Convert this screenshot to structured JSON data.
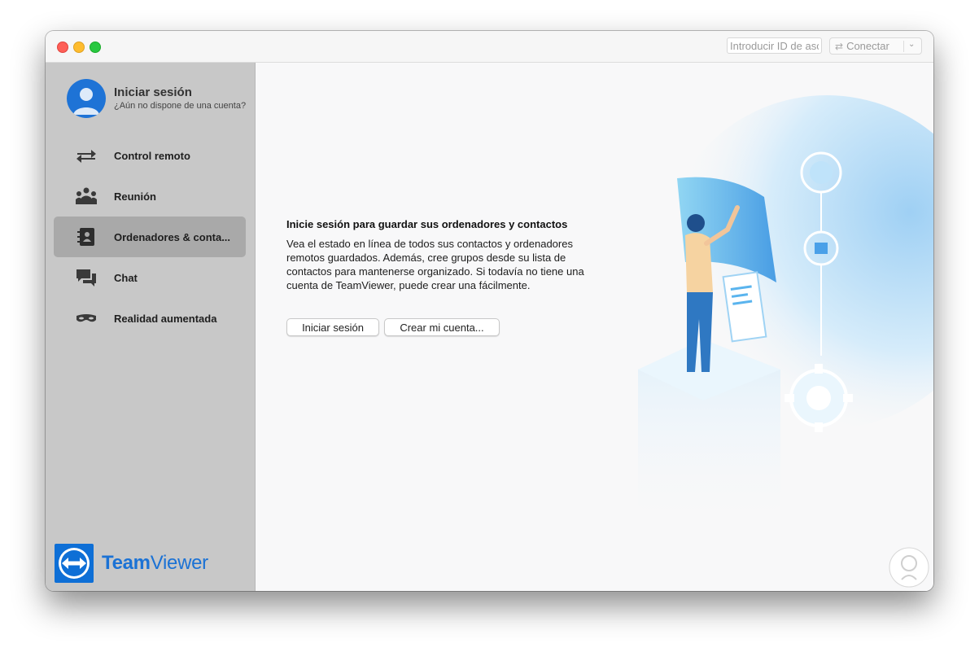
{
  "titlebar": {
    "id_placeholder": "Introducir ID de asociado",
    "connect_label": "Conectar"
  },
  "sidebar": {
    "login_title": "Iniciar sesión",
    "login_subtitle": "¿Aún no dispone de una cuenta?",
    "items": [
      {
        "label": "Control remoto",
        "icon": "arrows-icon",
        "active": false
      },
      {
        "label": "Reunión",
        "icon": "meeting-icon",
        "active": false
      },
      {
        "label": "Ordenadores & conta...",
        "icon": "contacts-book-icon",
        "active": true
      },
      {
        "label": "Chat",
        "icon": "chat-icon",
        "active": false
      },
      {
        "label": "Realidad aumentada",
        "icon": "ar-glasses-icon",
        "active": false
      }
    ],
    "brand": {
      "part1": "Team",
      "part2": "Viewer"
    }
  },
  "main": {
    "heading": "Inicie sesión para guardar sus ordenadores y contactos",
    "description": "Vea el estado en línea de todos sus contactos y ordenadores remotos guardados. Además, cree grupos desde su lista de contactos para mantenerse organizado. Si todavía no tiene una cuenta de TeamViewer, puede crear una fácilmente.",
    "login_button": "Iniciar sesión",
    "create_button": "Crear mi cuenta..."
  },
  "colors": {
    "accent": "#1b72d5",
    "sidebar_bg": "#c8c8c8",
    "active_item_bg": "#a9a9a9",
    "main_bg": "#f8f8f9"
  }
}
